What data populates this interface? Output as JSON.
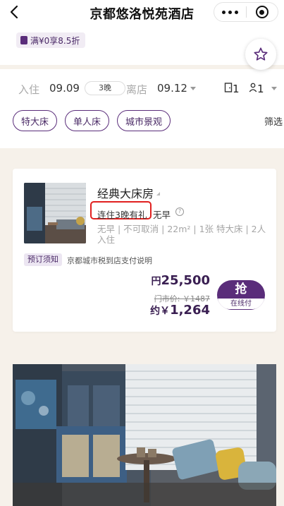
{
  "header": {
    "title": "京都悠洛悦苑酒店",
    "icons": [
      "back-icon",
      "more-icon",
      "record-icon"
    ]
  },
  "promo": {
    "tag": "满¥0享8.5折",
    "icon": "tag-icon"
  },
  "favorite": {
    "icon": "star-icon"
  },
  "dates": {
    "checkin_label": "入住",
    "checkin_date": "09.09",
    "nights": "3晚",
    "checkout_label": "离店",
    "checkout_date": "09.12",
    "rooms": "1",
    "guests": "1"
  },
  "chips": [
    "特大床",
    "单人床",
    "城市景观"
  ],
  "filter_label": "筛选",
  "room": {
    "name": "经典大床房",
    "promo": "连住3晚有礼",
    "breakfast": "无早",
    "details": "无早 | 不可取消 | 22m² | 1张 特大床 | 2人入住",
    "notice_badge": "预订须知",
    "notice_text": "京都城市税到店支付说明",
    "price_currency": "円",
    "price": "25,500",
    "market_price": "门市价: ￥1487",
    "approx_prefix": "约￥",
    "approx_price": "1,264",
    "book_label": "抢",
    "pay_label": "在线付"
  },
  "colors": {
    "accent": "#5a2d7a",
    "highlight": "#e0201f",
    "background": "#f6f1ea"
  }
}
